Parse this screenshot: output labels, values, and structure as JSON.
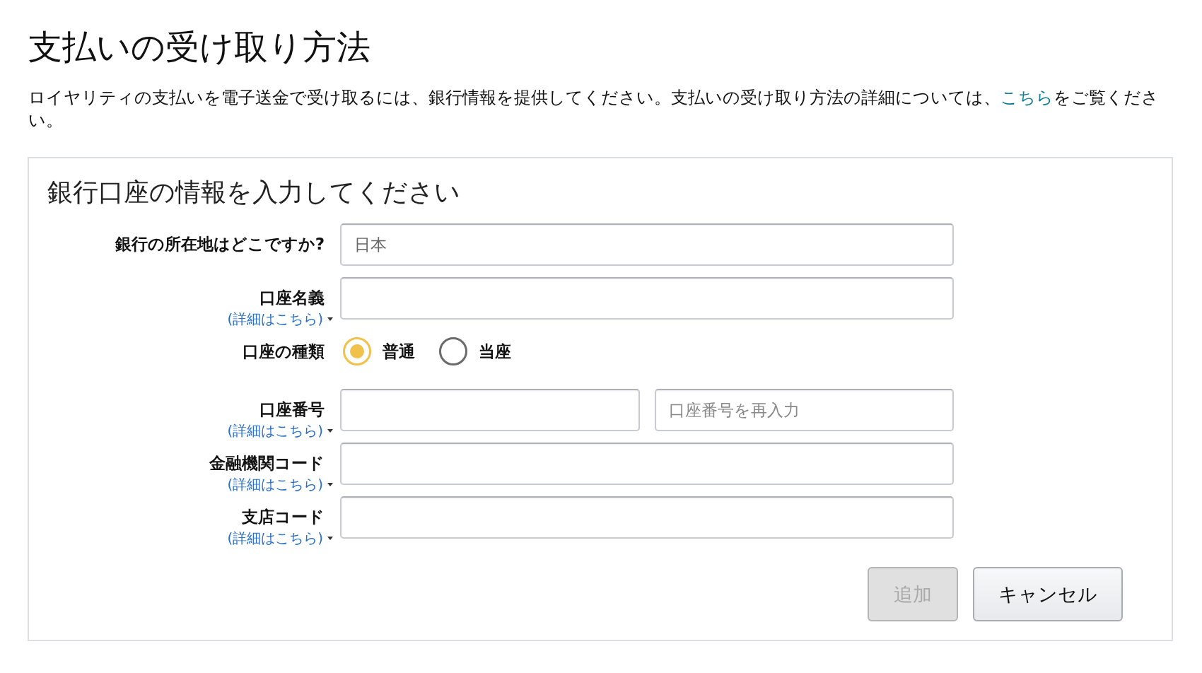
{
  "page": {
    "title": "支払いの受け取り方法",
    "description": {
      "before": "ロイヤリティの支払いを電子送金で受け取るには、銀行情報を提供してください。支払いの受け取り方法の詳細については、",
      "link": "こちら",
      "after": "をご覧ください。"
    }
  },
  "form": {
    "title": "銀行口座の情報を入力してください",
    "fields": [
      {
        "kind": "text",
        "label": "銀行の所在地はどこですか?",
        "value": "日本"
      },
      {
        "kind": "text",
        "label": "口座名義",
        "link": "(詳細はこちら)"
      },
      {
        "kind": "radio",
        "label": "口座の種類",
        "options": [
          {
            "label": "普通",
            "selected": true
          },
          {
            "label": "当座",
            "selected": false
          }
        ]
      },
      {
        "kind": "pair",
        "label": "口座番号",
        "link": "(詳細はこちら)",
        "confirm_placeholder": "口座番号を再入力"
      },
      {
        "kind": "text",
        "label": "金融機関コード",
        "link": "(詳細はこちら)"
      },
      {
        "kind": "text",
        "label": "支店コード",
        "link": "(詳細はこちら)"
      }
    ],
    "buttons": [
      {
        "label": "追加",
        "disabled": true
      },
      {
        "label": "キャンセル",
        "disabled": false
      }
    ]
  }
}
